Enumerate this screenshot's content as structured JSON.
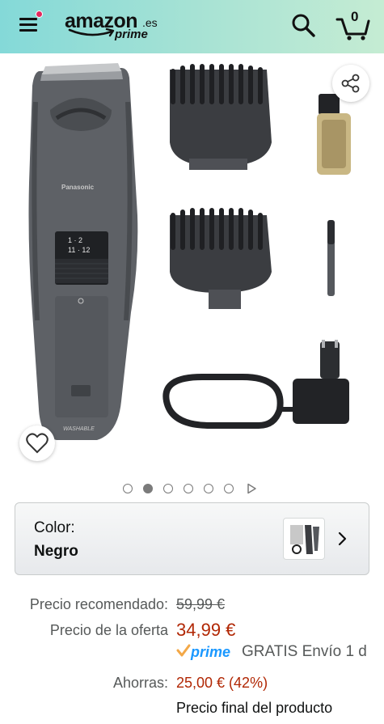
{
  "header": {
    "logo_word": "amazon",
    "logo_tld": ".es",
    "logo_prime": "prime",
    "cart_count": "0",
    "menu_icon": "hamburger-menu-icon",
    "search_icon": "search-icon",
    "cart_icon": "cart-icon",
    "notification_color": "#e4275d"
  },
  "gallery": {
    "product_brand_text": "Panasonic",
    "product_body_text": "WASHABLE",
    "dial_text_1": "1 · 2",
    "dial_text_2": "11 · 12",
    "share_icon": "share-icon",
    "wishlist_icon": "heart-icon",
    "image_count": 6,
    "active_image": 2,
    "has_video": true
  },
  "color_selector": {
    "label": "Color:",
    "value": "Negro"
  },
  "pricing": {
    "rrp_label": "Precio recomendado:",
    "rrp_value": "59,99 €",
    "offer_label": "Precio de la oferta",
    "offer_value": "34,99 €",
    "prime_label": "prime",
    "shipping_text": "GRATIS Envío 1 d",
    "savings_label": "Ahorras:",
    "savings_value": "25,00 € (42%)",
    "final_price_note": "Precio final del producto"
  },
  "colors": {
    "header_gradient_start": "#84d9d8",
    "header_gradient_end": "#c5ecd3",
    "price_red": "#b12704",
    "prime_blue": "#1a98ff"
  }
}
